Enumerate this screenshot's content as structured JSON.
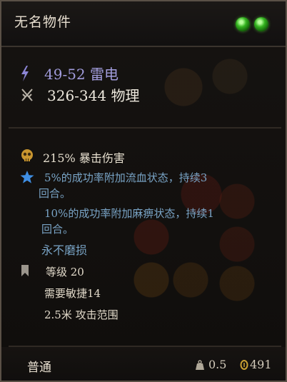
{
  "item": {
    "name": "无名物件",
    "damage": [
      {
        "icon": "lightning-icon",
        "text": "49-52 雷电",
        "color": "#a19cdc"
      },
      {
        "icon": "crossed-swords-icon",
        "text": "326-344 物理",
        "color": "#ede8dd"
      }
    ],
    "properties": {
      "crit": "215% 暴击伤害",
      "bleed_line1": "5%的成功率附加流血状态，持续3",
      "bleed_line2": "回合。",
      "paralysis_line1": "10%的成功率附加麻痹状态，持续1",
      "paralysis_line2": "回合。",
      "unbreakable": "永不磨损",
      "level": "等级 20",
      "requirement": "需要敏捷14",
      "range": "2.5米 攻击范围"
    },
    "footer": {
      "rarity": "普通",
      "weight": "0.5",
      "price": "491"
    }
  },
  "colors": {
    "accent_green": "#33b31f",
    "effect_blue": "#79a4c6",
    "electric_purple": "#a19cdc"
  }
}
